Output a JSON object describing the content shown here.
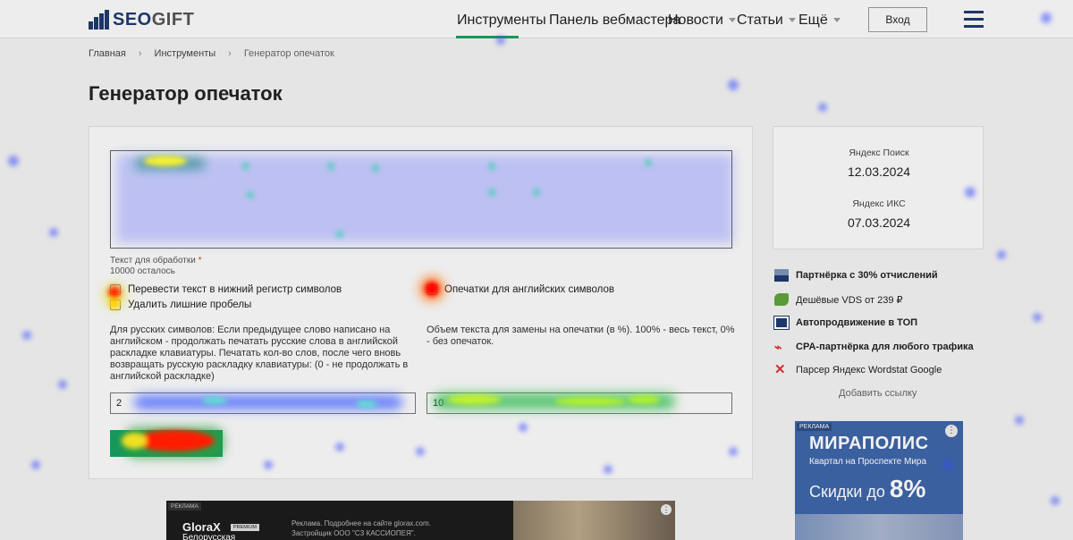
{
  "header": {
    "logo_text_a": "SEO",
    "logo_text_b": "GIFT",
    "nav": [
      {
        "label": "Инструменты",
        "active": true
      },
      {
        "label": "Панель вебмастера"
      },
      {
        "label": "Новости",
        "dropdown": true
      },
      {
        "label": "Статьи",
        "dropdown": true
      },
      {
        "label": "Ещё",
        "dropdown": true
      }
    ],
    "login_label": "Вход",
    "menu_icon": "hamburger-icon"
  },
  "breadcrumb": [
    "Главная",
    "Инструменты",
    "Генератор опечаток"
  ],
  "page_title": "Генератор опечаток",
  "tool": {
    "textarea_label": "Текст для обработки",
    "textarea_required": "*",
    "remaining": "10000 осталось",
    "options": {
      "lowercase": "Перевести текст в нижний регистр символов",
      "trim_spaces": "Удалить лишние пробелы",
      "english_typos": "Опечатки для английских символов"
    },
    "russian_desc": "Для русских символов: Если предыдущее слово написано на английском - продолжать печатать русские слова в английской раскладке клавиатуры. Печатать кол-во слов, после чего вновь возвращать русскую раскладку клавиатуры: (0 - не продолжать в английской раскладке)",
    "percent_desc": "Объем текста для замены на опечатки (в %). 100% - весь текст, 0% - без опечаток.",
    "russian_value": "2",
    "percent_value": "10",
    "submit_label": ""
  },
  "dates": {
    "search_label": "Яндекс Поиск",
    "search_date": "12.03.2024",
    "iks_label": "Яндекс ИКС",
    "iks_date": "07.03.2024"
  },
  "links": [
    {
      "label": "Партнёрка с 30% отчислений",
      "bold": true,
      "icon": "chart-icon"
    },
    {
      "label": "Дешёвые VDS от 239 ₽",
      "bold": false,
      "icon": "server-icon"
    },
    {
      "label": "Автопродвижение в ТОП",
      "bold": true,
      "icon": "sape-icon"
    },
    {
      "label": "CPA-партнёрка для любого трафика",
      "bold": true,
      "icon": "cpa-icon"
    },
    {
      "label": "Парсер Яндекс Wordstat Google",
      "bold": false,
      "icon": "parser-icon"
    }
  ],
  "add_link": "Добавить ссылку",
  "ad_right": {
    "tag": "РЕКЛАМА",
    "brand": "МИРАПОЛИС",
    "subtitle": "Квартал на Проспекте Мира",
    "offer_prefix": "Скидки до",
    "offer_value": "8%"
  },
  "ad_bottom": {
    "tag": "РЕКЛАМА",
    "brand": "GloraX",
    "premium": "PREMIUM",
    "city": "Белорусская",
    "line1": "Реклама. Подробнее на сайте glorax.com.",
    "line2": "Застройщик ООО \"СЗ КАССИОПЕЯ\"."
  },
  "colors": {
    "accent": "#1aa060",
    "brand": "#1e3a6e",
    "ad_blue": "#3f66a8"
  }
}
